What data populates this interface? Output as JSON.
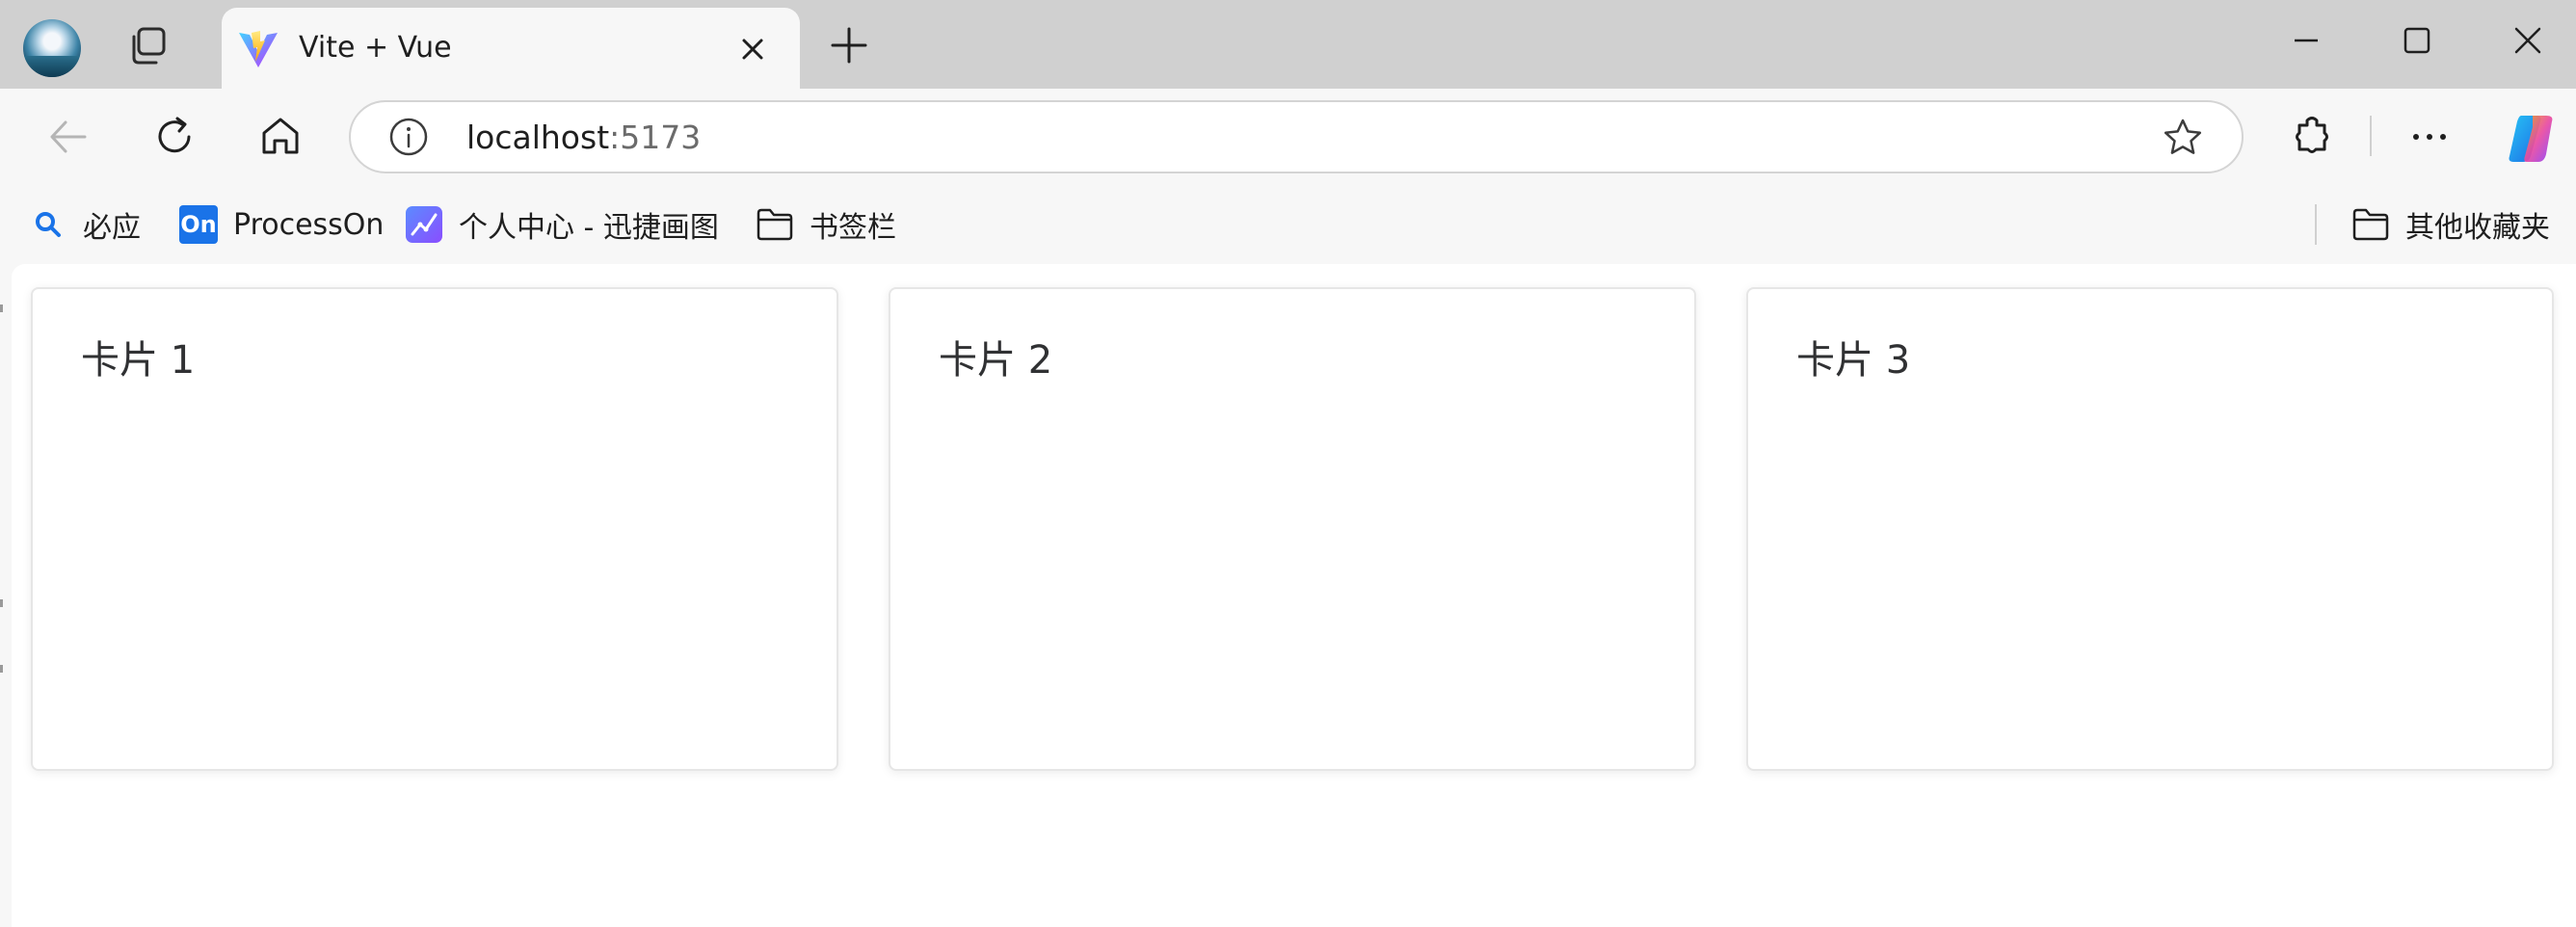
{
  "browser": {
    "tab": {
      "title": "Vite + Vue"
    },
    "address_bar": {
      "host": "localhost",
      "port": ":5173"
    },
    "bookmarks": [
      {
        "label": "必应",
        "icon": "search-icon"
      },
      {
        "label": "ProcessOn",
        "icon": "processon-icon",
        "badge": "On"
      },
      {
        "label": "个人中心 - 迅捷画图",
        "icon": "xunjie-icon"
      },
      {
        "label": "书签栏",
        "icon": "folder-icon"
      }
    ],
    "other_bookmarks": {
      "label": "其他收藏夹",
      "icon": "folder-icon"
    }
  },
  "page": {
    "cards": [
      {
        "title": "卡片 1"
      },
      {
        "title": "卡片 2"
      },
      {
        "title": "卡片 3"
      }
    ]
  },
  "colors": {
    "tabstrip": "#d0d0d0",
    "toolbar": "#f7f7f7",
    "page_background": "#ffffff",
    "card_border": "#e6e6e6",
    "card_text": "#303133"
  }
}
